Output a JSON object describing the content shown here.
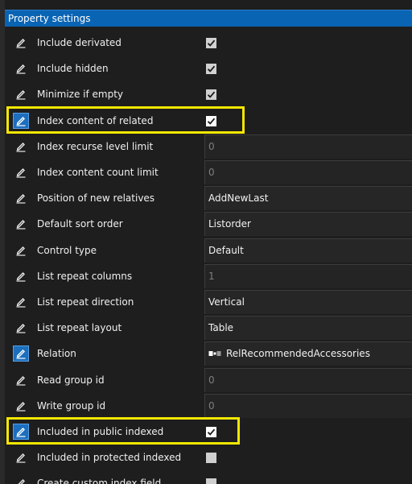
{
  "panel": {
    "title": "Property settings",
    "rows": [
      {
        "label": "Include derivated",
        "type": "checkbox",
        "checked": true,
        "icon": "pencil-icon",
        "active_icon": false
      },
      {
        "label": "Include hidden",
        "type": "checkbox",
        "checked": true,
        "icon": "pencil-icon",
        "active_icon": false
      },
      {
        "label": "Minimize if empty",
        "type": "checkbox",
        "checked": true,
        "icon": "pencil-icon",
        "active_icon": false
      },
      {
        "label": "Index content of related",
        "type": "checkbox",
        "checked": true,
        "icon": "pencil-icon",
        "active_icon": true,
        "highlighted": true
      },
      {
        "label": "Index recurse level limit",
        "type": "field",
        "value": "0",
        "disabled": true,
        "icon": "pencil-icon",
        "active_icon": false
      },
      {
        "label": "Index content count limit",
        "type": "field",
        "value": "0",
        "disabled": true,
        "icon": "pencil-icon",
        "active_icon": false
      },
      {
        "label": "Position of new relatives",
        "type": "field",
        "value": "AddNewLast",
        "disabled": false,
        "icon": "pencil-icon",
        "active_icon": false
      },
      {
        "label": "Default sort order",
        "type": "field",
        "value": "Listorder",
        "disabled": false,
        "icon": "pencil-icon",
        "active_icon": false
      },
      {
        "label": "Control type",
        "type": "field",
        "value": "Default",
        "disabled": false,
        "icon": "pencil-icon",
        "active_icon": false
      },
      {
        "label": "List repeat columns",
        "type": "field",
        "value": "1",
        "disabled": true,
        "icon": "pencil-icon",
        "active_icon": false
      },
      {
        "label": "List repeat direction",
        "type": "field",
        "value": "Vertical",
        "disabled": false,
        "icon": "pencil-icon",
        "active_icon": false
      },
      {
        "label": "List repeat layout",
        "type": "field",
        "value": "Table",
        "disabled": false,
        "icon": "pencil-icon",
        "active_icon": false
      },
      {
        "label": "Relation",
        "type": "field",
        "value": "RelRecommendedAccessories",
        "disabled": false,
        "icon": "pencil-icon",
        "active_icon": true,
        "has_relation_icon": true
      },
      {
        "label": "Read group id",
        "type": "field",
        "value": "0",
        "disabled": true,
        "icon": "pencil-icon",
        "active_icon": false
      },
      {
        "label": "Write group id",
        "type": "field",
        "value": "0",
        "disabled": true,
        "icon": "pencil-icon",
        "active_icon": false
      },
      {
        "label": "Included in public indexed",
        "type": "checkbox",
        "checked": true,
        "icon": "pencil-icon",
        "active_icon": true,
        "highlighted": true
      },
      {
        "label": "Included in protected indexed",
        "type": "checkbox",
        "checked": false,
        "icon": "pencil-icon",
        "active_icon": false
      },
      {
        "label": "Create custom index field",
        "type": "checkbox",
        "checked": false,
        "icon": "pencil-icon",
        "active_icon": false
      }
    ]
  },
  "colors": {
    "accent": "#0a64b4",
    "highlight": "#f5e800",
    "background": "#1e1e1e"
  }
}
